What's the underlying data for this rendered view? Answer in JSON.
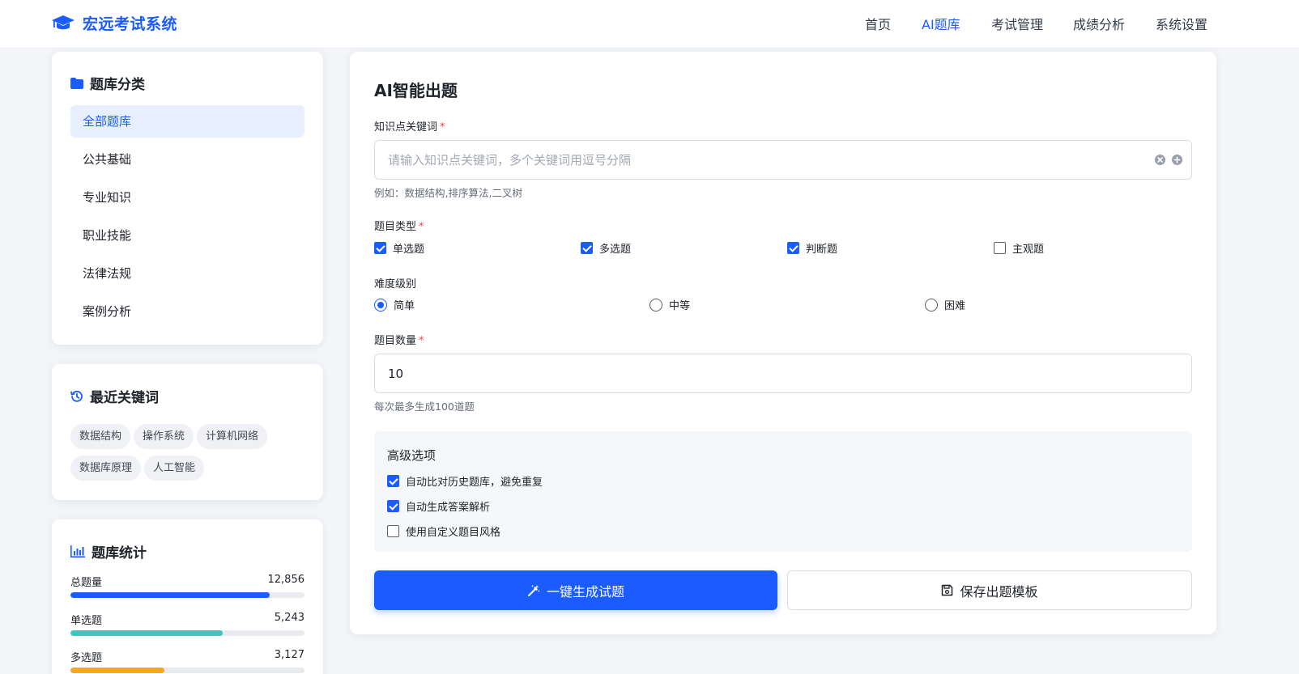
{
  "header": {
    "logo_text": "宏远考试系统",
    "nav": [
      "首页",
      "AI题库",
      "考试管理",
      "成绩分析",
      "系统设置"
    ],
    "active_nav": "AI题库"
  },
  "sidebar": {
    "categories": {
      "title": "题库分类",
      "items": [
        "全部题库",
        "公共基础",
        "专业知识",
        "职业技能",
        "法律法规",
        "案例分析"
      ],
      "active": "全部题库"
    },
    "recent_keywords": {
      "title": "最近关键词",
      "tags": [
        "数据结构",
        "操作系统",
        "计算机网络",
        "数据库原理",
        "人工智能"
      ]
    },
    "stats": {
      "title": "题库统计",
      "rows": [
        {
          "label": "总题量",
          "value": "12,856",
          "fraction": 0.85,
          "color": "#1a5cff"
        },
        {
          "label": "单选题",
          "value": "5,243",
          "fraction": 0.65,
          "color": "#3cc7c0"
        },
        {
          "label": "多选题",
          "value": "3,127",
          "fraction": 0.4,
          "color": "#f5a623"
        }
      ]
    }
  },
  "main": {
    "title": "AI智能出题",
    "keywords": {
      "label": "知识点关键词",
      "required_mark": "*",
      "placeholder": "请输入知识点关键词，多个关键词用逗号分隔",
      "value": "",
      "hint": "例如：数据结构,排序算法,二叉树"
    },
    "question_types": {
      "label": "题目类型",
      "required_mark": "*",
      "options": [
        {
          "label": "单选题",
          "checked": true
        },
        {
          "label": "多选题",
          "checked": true
        },
        {
          "label": "判断题",
          "checked": true
        },
        {
          "label": "主观题",
          "checked": false
        }
      ]
    },
    "difficulty": {
      "label": "难度级别",
      "options": [
        "简单",
        "中等",
        "困难"
      ],
      "selected": "简单"
    },
    "count": {
      "label": "题目数量",
      "required_mark": "*",
      "value": "10",
      "hint": "每次最多生成100道题"
    },
    "advanced": {
      "title": "高级选项",
      "options": [
        {
          "label": "自动比对历史题库，避免重复",
          "checked": true
        },
        {
          "label": "自动生成答案解析",
          "checked": true
        },
        {
          "label": "使用自定义题目风格",
          "checked": false
        }
      ]
    },
    "buttons": {
      "generate": "一键生成试题",
      "save_template": "保存出题模板"
    }
  },
  "colors": {
    "accent": "#1a5cff",
    "accent_light": "#e8f0ff",
    "required": "#f04747"
  }
}
